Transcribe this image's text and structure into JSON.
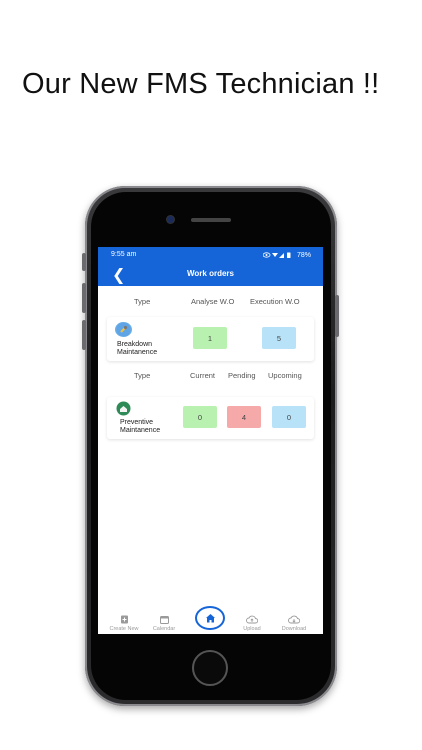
{
  "headline": "Our New FMS Technician !!",
  "status_bar": {
    "time": "9:55 am",
    "battery": "78%"
  },
  "app_bar": {
    "title": "Work orders"
  },
  "breakdown": {
    "headers": {
      "type": "Type",
      "analyse": "Analyse W.O",
      "execution": "Execution W.O"
    },
    "row": {
      "label_line1": "Breakdown",
      "label_line2": "Maintanence",
      "analyse_count": "1",
      "execution_count": "5"
    }
  },
  "preventive": {
    "headers": {
      "type": "Type",
      "current": "Current",
      "pending": "Pending",
      "upcoming": "Upcoming"
    },
    "row": {
      "label_line1": "Preventive",
      "label_line2": "Maintanence",
      "current_count": "0",
      "pending_count": "4",
      "upcoming_count": "0"
    }
  },
  "bottom_nav": {
    "create": "Create New",
    "calendar": "Calendar",
    "upload": "Upload",
    "download": "Download"
  },
  "colors": {
    "primary": "#1565d8",
    "green": "#b9f2b0",
    "blue": "#b7e2f8",
    "red": "#f6a9a9"
  },
  "icons": [
    "back-arrow-icon",
    "eye-icon",
    "wifi-icon",
    "signal-icon",
    "battery-icon",
    "wrench-avatar-icon",
    "home-avatar-icon",
    "file-plus-icon",
    "calendar-icon",
    "home-icon",
    "cloud-upload-icon",
    "cloud-download-icon"
  ]
}
